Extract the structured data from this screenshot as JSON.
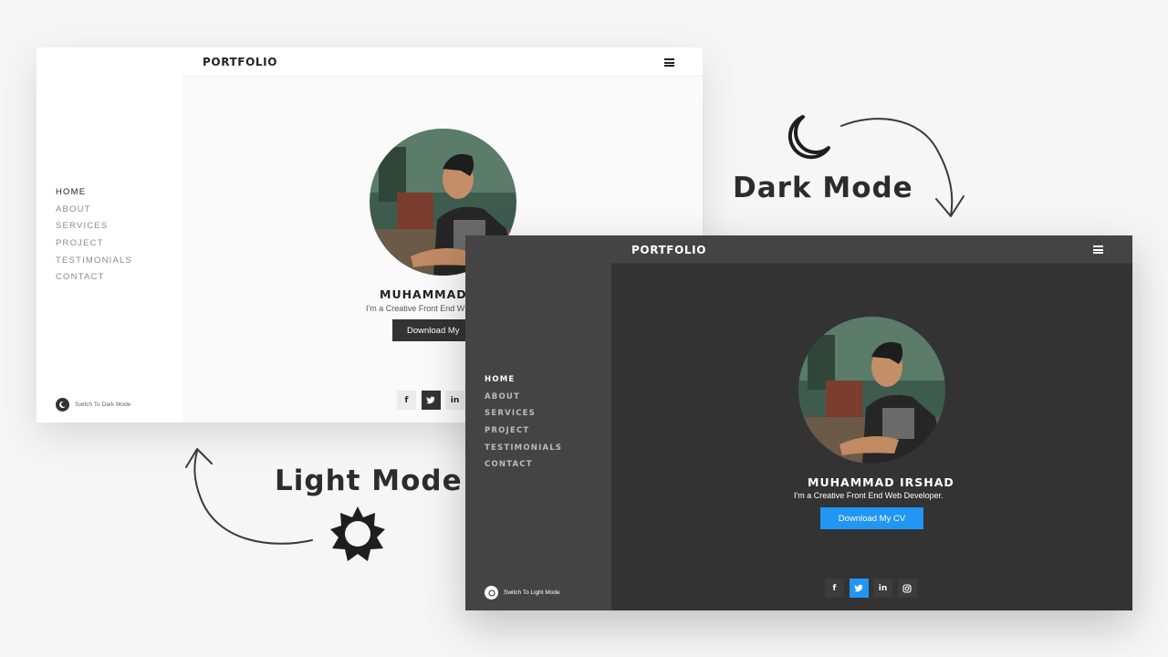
{
  "light_window": {
    "logo": "PORTFOLIO",
    "nav": [
      "HOME",
      "ABOUT",
      "SERVICES",
      "PROJECT",
      "TESTIMONIALS",
      "CONTACT"
    ],
    "active_nav": "HOME",
    "hero": {
      "name": "MUHAMMAD I",
      "subtitle": "I'm a Creative Front End W",
      "button": "Download My"
    },
    "socials": [
      "f",
      "t",
      "in"
    ],
    "switch_label": "Switch To Dark Mode",
    "switch_icon": "moon-icon",
    "colors": {
      "background": "#fafafa",
      "sidebar": "#ffffff",
      "accent": "#333333"
    }
  },
  "dark_window": {
    "logo": "PORTFOLIO",
    "nav": [
      "HOME",
      "ABOUT",
      "SERVICES",
      "PROJECT",
      "TESTIMONIALS",
      "CONTACT"
    ],
    "active_nav": "HOME",
    "hero": {
      "name": "MUHAMMAD IRSHAD",
      "subtitle": "I'm a Creative Front End Web Developer.",
      "button": "Download My CV"
    },
    "socials": [
      "f",
      "t",
      "in",
      "ig"
    ],
    "switch_label": "Switch To Light Mode",
    "switch_icon": "sun-icon",
    "colors": {
      "background": "#333333",
      "sidebar": "#444444",
      "accent": "#2196f3"
    }
  },
  "captions": {
    "dark": "Dark Mode",
    "light": "Light Mode"
  }
}
